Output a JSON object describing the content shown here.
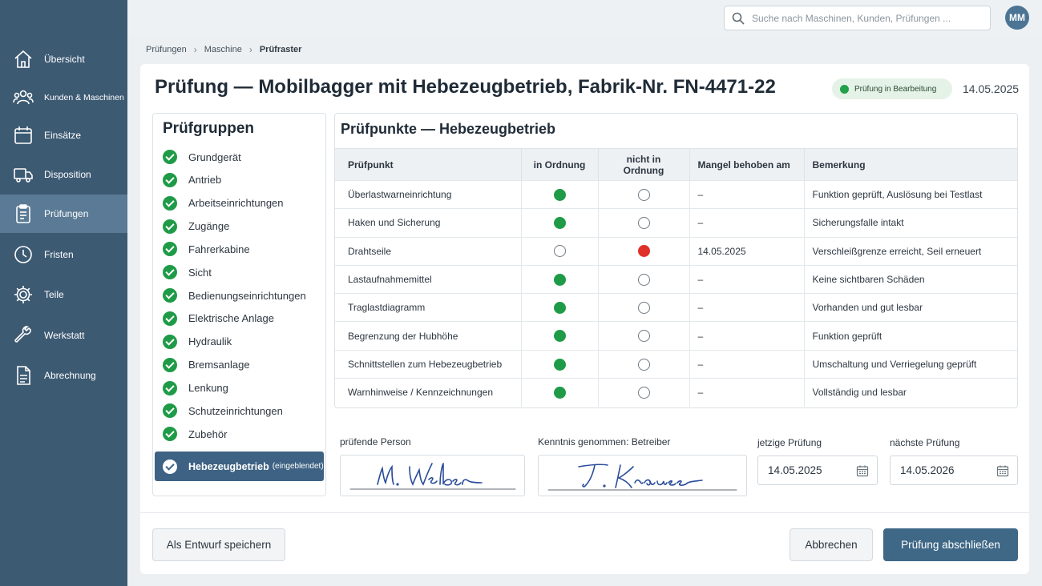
{
  "sidebar": {
    "items": [
      {
        "label": "Übersicht",
        "icon": "home-icon"
      },
      {
        "label": "Kunden & Maschinen",
        "icon": "users-icon"
      },
      {
        "label": "Einsätze",
        "icon": "calendar-icon"
      },
      {
        "label": "Disposition",
        "icon": "truck-icon"
      },
      {
        "label": "Prüfungen",
        "icon": "clipboard-icon",
        "active": true
      },
      {
        "label": "Fristen",
        "icon": "clock-icon"
      },
      {
        "label": "Teile",
        "icon": "gear-icon"
      },
      {
        "label": "Werkstatt",
        "icon": "wrench-icon"
      },
      {
        "label": "Abrechnung",
        "icon": "document-icon"
      }
    ]
  },
  "topbar": {
    "search_placeholder": "Suche nach Maschinen, Kunden, Prüfungen ...",
    "avatar_initials": "MM"
  },
  "breadcrumb": [
    "Prüfungen",
    "Maschine",
    "Prüfraster"
  ],
  "header": {
    "title": "Prüfung — Mobilbagger mit Hebezeugbetrieb, Fabrik-Nr. FN-4471-22",
    "status": "Prüfung in Bearbeitung",
    "date": "14.05.2025"
  },
  "groups": {
    "title": "Prüfgruppen",
    "items": [
      "Grundgerät",
      "Antrieb",
      "Arbeitseinrichtungen",
      "Zugänge",
      "Fahrerkabine",
      "Sicht",
      "Bedienungseinrichtungen",
      "Elektrische Anlage",
      "Hydraulik",
      "Bremsanlage",
      "Lenkung",
      "Schutzeinrichtungen",
      "Zubehör"
    ],
    "active": {
      "label": "Hebezeugbetrieb",
      "sub": "(eingeblendet)"
    }
  },
  "points": {
    "title": "Prüfpunkte — Hebezeugbetrieb",
    "columns": [
      "Prüfpunkt",
      "in Ordnung",
      "nicht in Ordnung",
      "Mangel behoben am",
      "Bemerkung"
    ],
    "rows": [
      {
        "name": "Überlastwarneinrichtung",
        "ok": true,
        "fixed": "–",
        "remark": "Funktion geprüft, Auslösung bei Testlast"
      },
      {
        "name": "Haken und Sicherung",
        "ok": true,
        "fixed": "–",
        "remark": "Sicherungsfalle intakt"
      },
      {
        "name": "Drahtseile",
        "ok": false,
        "fixed": "14.05.2025",
        "remark": "Verschleißgrenze erreicht, Seil erneuert"
      },
      {
        "name": "Lastaufnahmemittel",
        "ok": true,
        "fixed": "–",
        "remark": "Keine sichtbaren Schäden"
      },
      {
        "name": "Traglastdiagramm",
        "ok": true,
        "fixed": "–",
        "remark": "Vorhanden und gut lesbar"
      },
      {
        "name": "Begrenzung der Hubhöhe",
        "ok": true,
        "fixed": "–",
        "remark": "Funktion geprüft"
      },
      {
        "name": "Schnittstellen zum Hebezeugbetrieb",
        "ok": true,
        "fixed": "–",
        "remark": "Umschaltung und Verriegelung geprüft"
      },
      {
        "name": "Warnhinweise / Kennzeichnungen",
        "ok": true,
        "fixed": "–",
        "remark": "Vollständig und lesbar"
      }
    ]
  },
  "signatures": {
    "inspector_label": "prüfende Person",
    "inspector_sig": "M. Weber",
    "operator_label": "Kenntnis genommen: Betreiber",
    "operator_sig": "T. Krause"
  },
  "dates": {
    "current_label": "jetzige Prüfung",
    "current_value": "14.05.2025",
    "next_label": "nächste Prüfung",
    "next_value": "14.05.2026"
  },
  "footer": {
    "draft": "Als Entwurf speichern",
    "cancel": "Abbrechen",
    "finish": "Prüfung abschließen"
  },
  "colors": {
    "sidebar": "#3d5a73",
    "ok": "#1f9b47",
    "defect": "#e0302a",
    "primary": "#3f6887"
  }
}
